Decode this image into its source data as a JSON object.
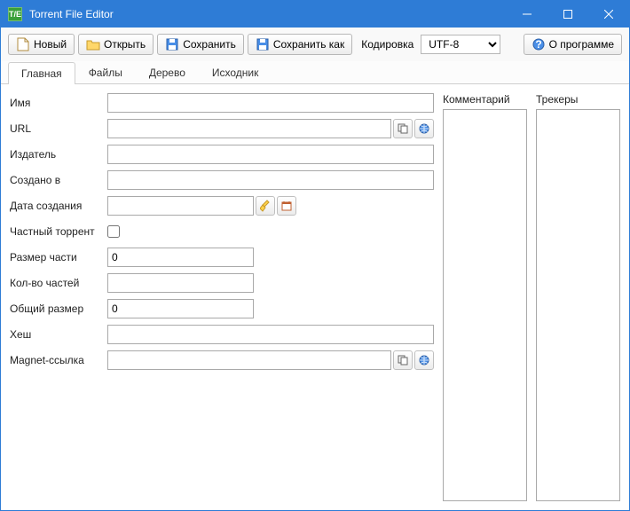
{
  "title": "Torrent File Editor",
  "toolbar": {
    "new": "Новый",
    "open": "Открыть",
    "save": "Сохранить",
    "saveas": "Сохранить как",
    "encoding_label": "Кодировка",
    "encoding_value": "UTF-8",
    "about": "О программе"
  },
  "tabs": {
    "main": "Главная",
    "files": "Файлы",
    "tree": "Дерево",
    "source": "Исходник"
  },
  "form": {
    "name_label": "Имя",
    "name_value": "",
    "url_label": "URL",
    "url_value": "",
    "publisher_label": "Издатель",
    "publisher_value": "",
    "created_in_label": "Создано в",
    "created_in_value": "",
    "creation_date_label": "Дата создания",
    "creation_date_value": "",
    "private_label": "Частный торрент",
    "private_value": false,
    "piece_size_label": "Размер части",
    "piece_size_value": "0",
    "piece_count_label": "Кол-во частей",
    "piece_count_value": "",
    "total_size_label": "Общий размер",
    "total_size_value": "0",
    "hash_label": "Хеш",
    "hash_value": "",
    "magnet_label": "Magnet-ссылка",
    "magnet_value": ""
  },
  "side": {
    "comment_label": "Комментарий",
    "trackers_label": "Трекеры"
  }
}
